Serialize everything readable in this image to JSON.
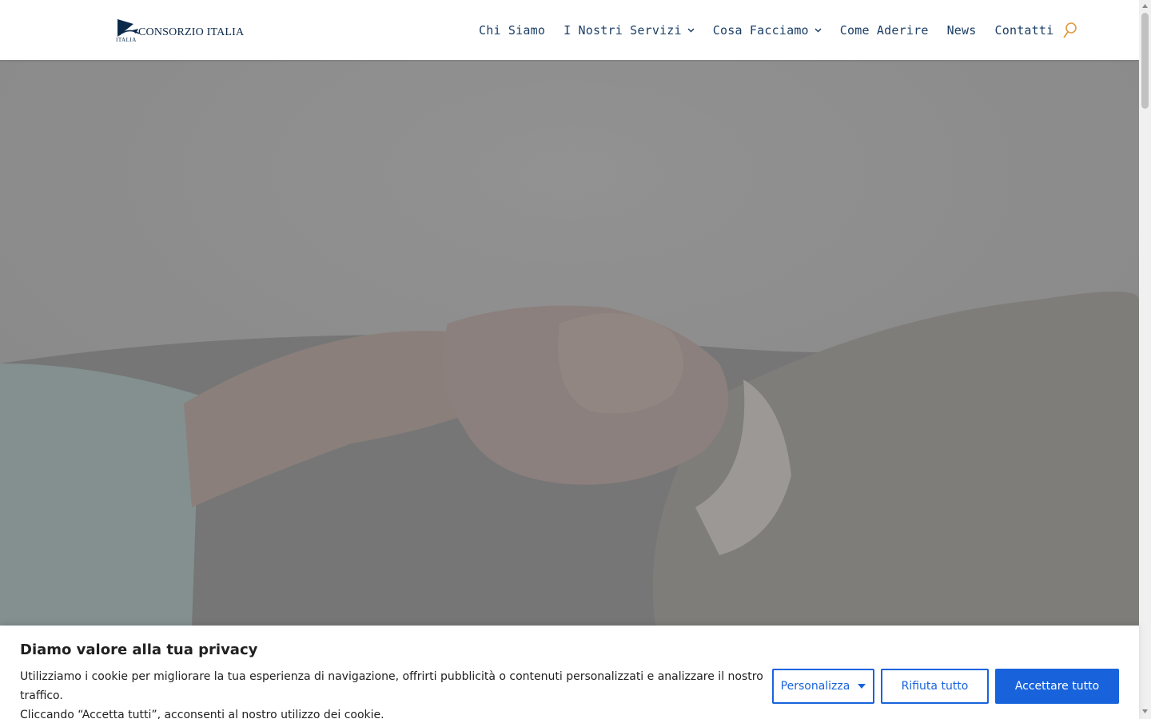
{
  "header": {
    "logo_text": "CONSORZIO ITALIA",
    "logo_sub": "ITALIA",
    "nav": [
      {
        "label": "Chi Siamo",
        "dropdown": false
      },
      {
        "label": "I Nostri Servizi",
        "dropdown": true
      },
      {
        "label": "Cosa Facciamo",
        "dropdown": true
      },
      {
        "label": "Come Aderire",
        "dropdown": false
      },
      {
        "label": "News",
        "dropdown": false
      },
      {
        "label": "Contatti",
        "dropdown": false
      }
    ],
    "search_icon": "search-icon"
  },
  "cookie_banner": {
    "title": "Diamo valore alla tua privacy",
    "text_line1": "Utilizziamo i cookie per migliorare la tua esperienza di navigazione, offrirti pubblicità o contenuti personalizzati e analizzare il nostro traffico.",
    "text_line2": "Cliccando “Accetta tutti”, acconsenti al nostro utilizzo dei cookie.",
    "customize_label": "Personalizza",
    "reject_label": "Rifiuta tutto",
    "accept_label": "Accettare tutto"
  },
  "colors": {
    "nav_text": "#1b3f67",
    "search_accent": "#e09a3e",
    "button_blue": "#1863dc",
    "hero_overlay": "#8c8c8c"
  }
}
